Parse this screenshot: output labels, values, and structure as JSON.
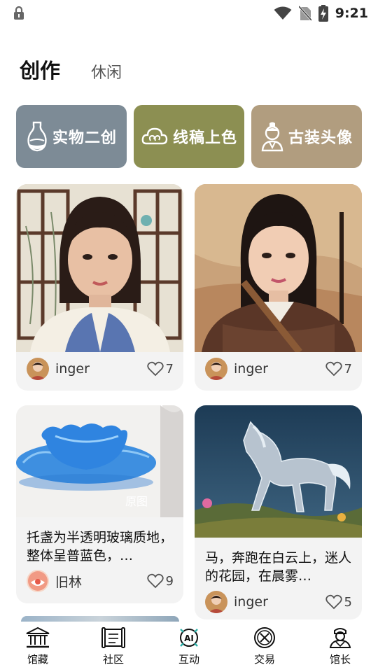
{
  "status_bar": {
    "time": "9:21"
  },
  "tabs": {
    "active": "创作",
    "inactive": "休闲"
  },
  "features": [
    {
      "label": "实物二创",
      "icon": "vase-icon",
      "color": "#7d8b96"
    },
    {
      "label": "线稿上色",
      "icon": "cloud-outline-icon",
      "color": "#8c8f52"
    },
    {
      "label": "古装头像",
      "icon": "ancient-portrait-icon",
      "color": "#b19d7f"
    }
  ],
  "cards": [
    {
      "author": "inger",
      "likes": "7",
      "image": "portrait-qing-dress"
    },
    {
      "author": "inger",
      "likes": "7",
      "image": "portrait-warrior-armor"
    },
    {
      "text": "托盏为半透明玻璃质地，整体呈普蓝色，…",
      "overlay": "原图",
      "author": "旧林",
      "likes": "9",
      "image": "blue-glass-cup-saucer"
    },
    {
      "text": "马，奔跑在白云上，迷人的花园，在晨雾…",
      "author": "inger",
      "likes": "5",
      "image": "silver-horse-garden"
    }
  ],
  "nav": [
    {
      "label": "馆藏",
      "icon": "museum-icon"
    },
    {
      "label": "社区",
      "icon": "scroll-icon"
    },
    {
      "label": "互动",
      "icon": "ai-icon"
    },
    {
      "label": "交易",
      "icon": "coin-icon"
    },
    {
      "label": "馆长",
      "icon": "curator-icon"
    }
  ]
}
